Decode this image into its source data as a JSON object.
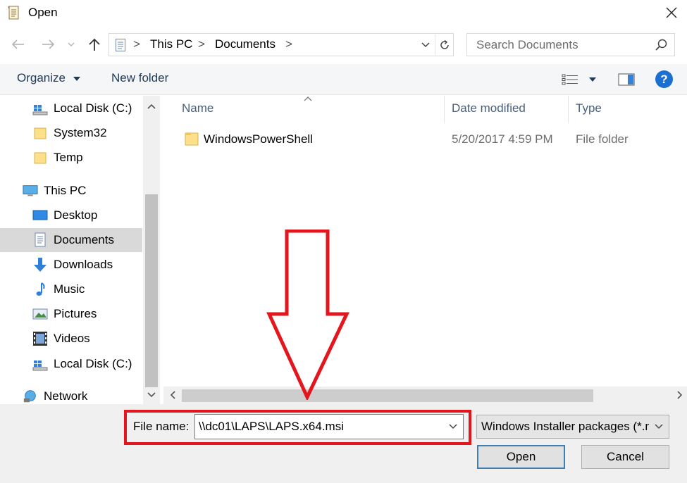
{
  "window": {
    "title": "Open",
    "icon": "scroll-document-icon"
  },
  "nav": {
    "back_icon": "back-arrow-icon",
    "forward_icon": "forward-arrow-icon",
    "recent_icon": "recent-locations-chevron-icon",
    "up_icon": "up-arrow-icon"
  },
  "address": {
    "crumbs": [
      "This PC",
      "Documents"
    ],
    "separator": ">"
  },
  "search": {
    "placeholder": "Search Documents"
  },
  "toolbar": {
    "organize_label": "Organize",
    "new_folder_label": "New folder",
    "help_label": "?"
  },
  "navpane": {
    "items": [
      {
        "label": "Local Disk (C:)",
        "icon": "local-disk-icon"
      },
      {
        "label": "System32",
        "icon": "folder-icon"
      },
      {
        "label": "Temp",
        "icon": "folder-icon"
      },
      {
        "label": "This PC",
        "icon": "computer-icon"
      },
      {
        "label": "Desktop",
        "icon": "desktop-icon"
      },
      {
        "label": "Documents",
        "icon": "documents-icon",
        "selected": true
      },
      {
        "label": "Downloads",
        "icon": "downloads-icon"
      },
      {
        "label": "Music",
        "icon": "music-icon"
      },
      {
        "label": "Pictures",
        "icon": "pictures-icon"
      },
      {
        "label": "Videos",
        "icon": "videos-icon"
      },
      {
        "label": "Local Disk (C:)",
        "icon": "local-disk-icon"
      },
      {
        "label": "Network",
        "icon": "network-icon"
      }
    ]
  },
  "filelist": {
    "columns": [
      "Name",
      "Date modified",
      "Type"
    ],
    "rows": [
      {
        "name": "WindowsPowerShell",
        "date": "5/20/2017 4:59 PM",
        "type": "File folder"
      }
    ]
  },
  "bottom": {
    "filename_label": "File name:",
    "filename_value": "\\\\dc01\\LAPS\\LAPS.x64.msi",
    "filter_value": "Windows Installer packages (*.msi)",
    "open_label": "Open",
    "cancel_label": "Cancel"
  },
  "colors": {
    "annotation_red": "#e3161e",
    "help_blue": "#1a6fd1",
    "selection_gray": "#d9d9d9",
    "link_text": "#1e395b"
  }
}
